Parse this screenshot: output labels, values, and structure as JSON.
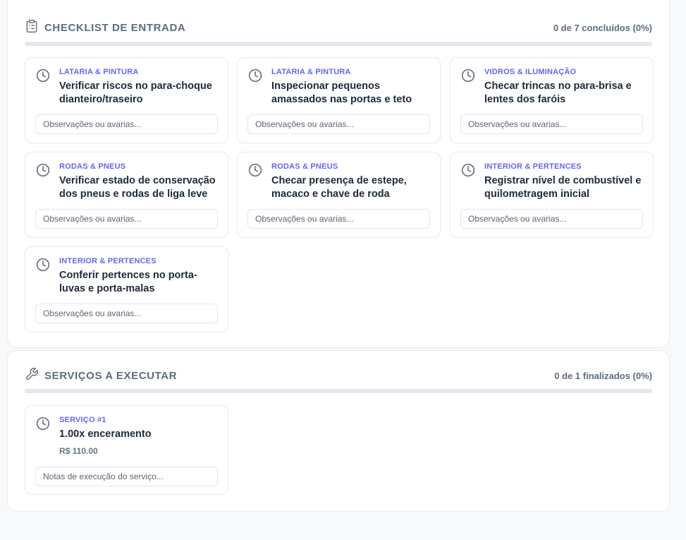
{
  "checklist": {
    "title": "CHECKLIST DE ENTRADA",
    "progress_text": "0 de 7 concluídos (0%)",
    "progress_value": 0,
    "items": [
      {
        "category": "LATARIA & PINTURA",
        "title": "Verificar riscos no para-choque dianteiro/traseiro",
        "placeholder": "Observações ou avarias..."
      },
      {
        "category": "LATARIA & PINTURA",
        "title": "Inspecionar pequenos amassados nas portas e teto",
        "placeholder": "Observações ou avarias..."
      },
      {
        "category": "VIDROS & ILUMINAÇÃO",
        "title": "Checar trincas no para-brisa e lentes dos faróis",
        "placeholder": "Observações ou avarias..."
      },
      {
        "category": "RODAS & PNEUS",
        "title": "Verificar estado de conservação dos pneus e rodas de liga leve",
        "placeholder": "Observações ou avarias..."
      },
      {
        "category": "RODAS & PNEUS",
        "title": "Checar presença de estepe, macaco e chave de roda",
        "placeholder": "Observações ou avarias..."
      },
      {
        "category": "INTERIOR & PERTENCES",
        "title": "Registrar nível de combustível e quilometragem inicial",
        "placeholder": "Observações ou avarias..."
      },
      {
        "category": "INTERIOR & PERTENCES",
        "title": "Conferir pertences no porta-luvas e porta-malas",
        "placeholder": "Observações ou avarias..."
      }
    ]
  },
  "services": {
    "title": "SERVIÇOS A EXECUTAR",
    "progress_text": "0 de 1 finalizados (0%)",
    "progress_value": 0,
    "items": [
      {
        "category": "SERVIÇO #1",
        "title": "1.00x enceramento",
        "price": "R$ 110.00",
        "placeholder": "Notas de execução do serviço..."
      }
    ]
  },
  "colors": {
    "accent": "#6366f1",
    "header_text": "#5f6b7d",
    "icon": "#6b7280"
  },
  "icons": {
    "checklist": "clipboard-list-icon",
    "services": "wrench-icon",
    "item_status": "clock-icon"
  }
}
